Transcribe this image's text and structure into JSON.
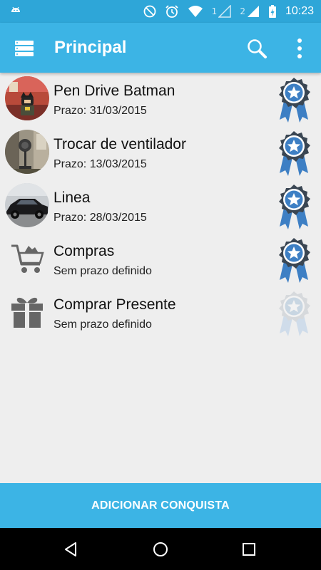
{
  "status_bar": {
    "time": "10:23",
    "sim1": "1",
    "sim2": "2",
    "icons": [
      "android-debug-icon",
      "do-not-disturb-icon",
      "alarm-icon",
      "wifi-icon",
      "signal-icon",
      "battery-charging-icon"
    ]
  },
  "app_bar": {
    "title": "Principal",
    "menu_icon": "drawer-menu-icon",
    "search_icon": "search-icon",
    "overflow_icon": "more-vert-icon"
  },
  "items": [
    {
      "title": "Pen Drive Batman",
      "subtitle": "Prazo: 31/03/2015",
      "image": "photo",
      "medal_state": "active"
    },
    {
      "title": "Trocar de ventilador",
      "subtitle": "Prazo: 13/03/2015",
      "image": "photo",
      "medal_state": "active"
    },
    {
      "title": "Linea",
      "subtitle": "Prazo: 28/03/2015",
      "image": "photo",
      "medal_state": "active"
    },
    {
      "title": "Compras",
      "subtitle": "Sem prazo definido",
      "image": "cart-icon",
      "medal_state": "active"
    },
    {
      "title": "Comprar Presente",
      "subtitle": "Sem prazo definido",
      "image": "gift-icon",
      "medal_state": "inactive"
    }
  ],
  "add_button": {
    "label": "ADICIONAR CONQUISTA"
  },
  "nav_bar": {
    "icons": [
      "back-icon",
      "home-icon",
      "recents-icon"
    ]
  },
  "colors": {
    "status_bar": "#2ea6d8",
    "app_bar": "#3cb4e5",
    "background": "#eeeeee",
    "medal_dark": "#3a4653",
    "medal_blue": "#3d7fc4",
    "medal_inactive": "#c8d6e2"
  }
}
